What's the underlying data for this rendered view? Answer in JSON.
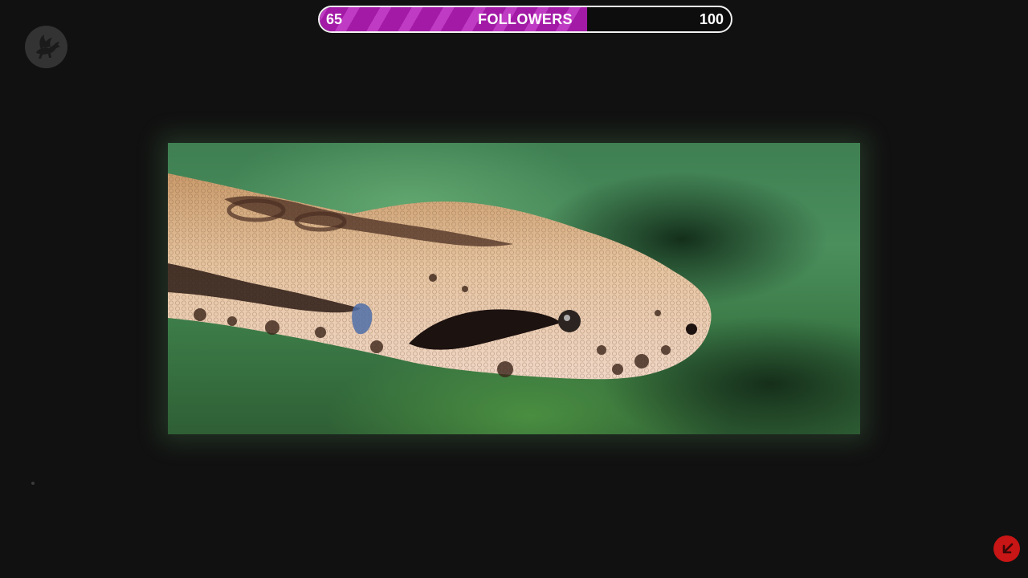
{
  "followers_bar": {
    "current": "65",
    "label": "FOLLOWERS",
    "goal": "100",
    "progress_fraction": 0.65,
    "fill_color": "#a21aa6",
    "stripe_color": "#bf3bc3"
  },
  "logo": {
    "icon": "pegasus-icon"
  },
  "photo": {
    "subject": "snake-head-photo"
  },
  "corner_button": {
    "icon": "arrow-down-left-icon",
    "color": "#c81515"
  }
}
